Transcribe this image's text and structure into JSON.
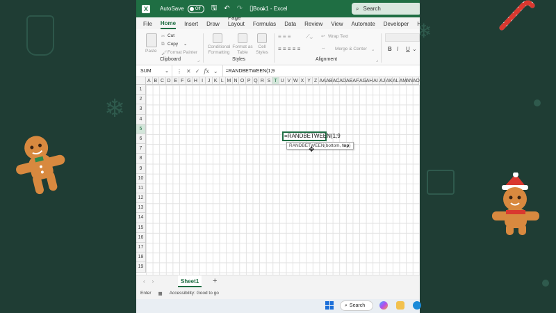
{
  "titlebar": {
    "autosave_label": "AutoSave",
    "autosave_state": "Off",
    "doc_title": "Book1 - Excel",
    "search_label": "Search"
  },
  "ribbon_tabs": [
    "File",
    "Home",
    "Insert",
    "Draw",
    "Page Layout",
    "Formulas",
    "Data",
    "Review",
    "View",
    "Automate",
    "Developer",
    "Help"
  ],
  "active_tab": "Home",
  "ribbon": {
    "paste": "Paste",
    "cut": "Cut",
    "copy": "Copy",
    "format_painter": "Format Painter",
    "clipboard_group": "Clipboard",
    "conditional_formatting": "Conditional Formatting",
    "format_as_table": "Format as Table",
    "cell_styles": "Cell Styles",
    "styles_group": "Styles",
    "wrap_text": "Wrap Text",
    "merge_center": "Merge & Center",
    "alignment_group": "Alignment",
    "bold": "B",
    "italic": "I",
    "underline": "U"
  },
  "formula_bar": {
    "name_box": "SUM",
    "formula": "=RANDBETWEEN(1;9"
  },
  "columns": [
    "A",
    "B",
    "C",
    "D",
    "E",
    "F",
    "G",
    "H",
    "I",
    "J",
    "K",
    "L",
    "M",
    "N",
    "O",
    "P",
    "Q",
    "R",
    "S",
    "T",
    "U",
    "V",
    "W",
    "X",
    "Y",
    "Z",
    "AA",
    "AB",
    "AC",
    "AD",
    "AE",
    "AF",
    "AG",
    "AH",
    "AI",
    "AJ",
    "AK",
    "AL",
    "AM",
    "AN",
    "AO"
  ],
  "selected_column": "T",
  "rows": [
    "1",
    "2",
    "3",
    "4",
    "5",
    "6",
    "7",
    "8",
    "9",
    "10",
    "11",
    "12",
    "13",
    "14",
    "15",
    "16",
    "17",
    "18",
    "19"
  ],
  "selected_row": "5",
  "active_cell": {
    "content": "=RANDBETWEEN(1;9",
    "tooltip_prefix": "RANDBETWEEN(bottom, ",
    "tooltip_bold": "top",
    "tooltip_suffix": ")"
  },
  "sheet_tab": "Sheet1",
  "status": {
    "mode": "Enter",
    "accessibility": "Accessibility: Good to go"
  },
  "taskbar": {
    "search": "Search"
  },
  "colors": {
    "excel_green": "#1f6e43",
    "background": "#1f3d34"
  }
}
